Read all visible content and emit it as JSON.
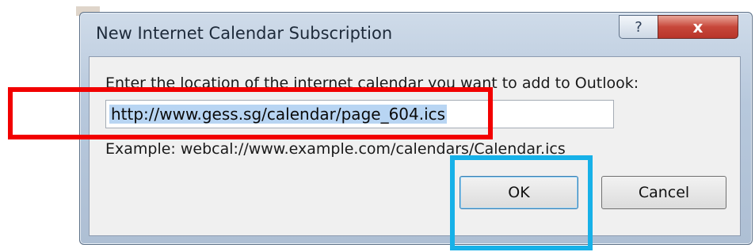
{
  "dialog": {
    "title": "New Internet Calendar Subscription",
    "help_symbol": "?",
    "close_symbol": "x",
    "prompt": "Enter the location of the internet calendar you want to add to Outlook:",
    "url_value": "http://www.gess.sg/calendar/page_604.ics",
    "example": "Example: webcal://www.example.com/calendars/Calendar.ics",
    "ok_label": "OK",
    "cancel_label": "Cancel"
  },
  "colors": {
    "highlight_red": "#f20000",
    "highlight_blue": "#17b1e8",
    "selection": "#b8d5f3"
  }
}
